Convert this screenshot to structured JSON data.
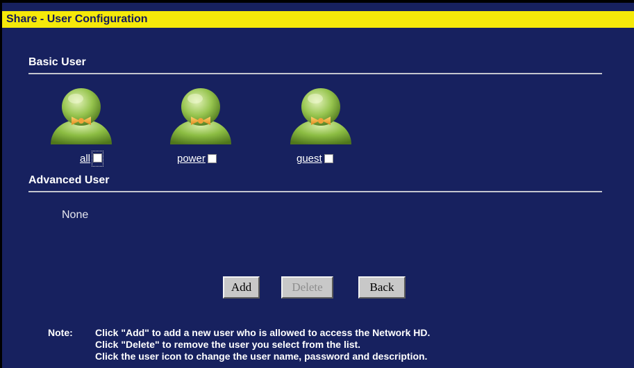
{
  "window": {
    "title": "Share - User Configuration"
  },
  "basic_section": {
    "heading": "Basic User",
    "users": [
      {
        "name": "all",
        "checked": false,
        "icon": "user-icon"
      },
      {
        "name": "power",
        "checked": false,
        "icon": "user-icon"
      },
      {
        "name": "guest",
        "checked": false,
        "icon": "user-icon"
      }
    ]
  },
  "advanced_section": {
    "heading": "Advanced User",
    "empty_text": "None"
  },
  "buttons": {
    "add": "Add",
    "delete": "Delete",
    "delete_enabled": false,
    "back": "Back"
  },
  "note": {
    "label": "Note:",
    "lines": [
      "Click \"Add\" to add a new user who is allowed to access the Network HD.",
      "Click \"Delete\" to remove the user you select from the list.",
      "Click the user icon to change the user name, password and description."
    ]
  },
  "colors": {
    "background": "#17215f",
    "title_bar": "#f5e90a",
    "title_text": "#141a5a",
    "divider": "#c4c6cf",
    "user_icon_body": "#8cbd43",
    "user_icon_bow": "#f0a030"
  }
}
